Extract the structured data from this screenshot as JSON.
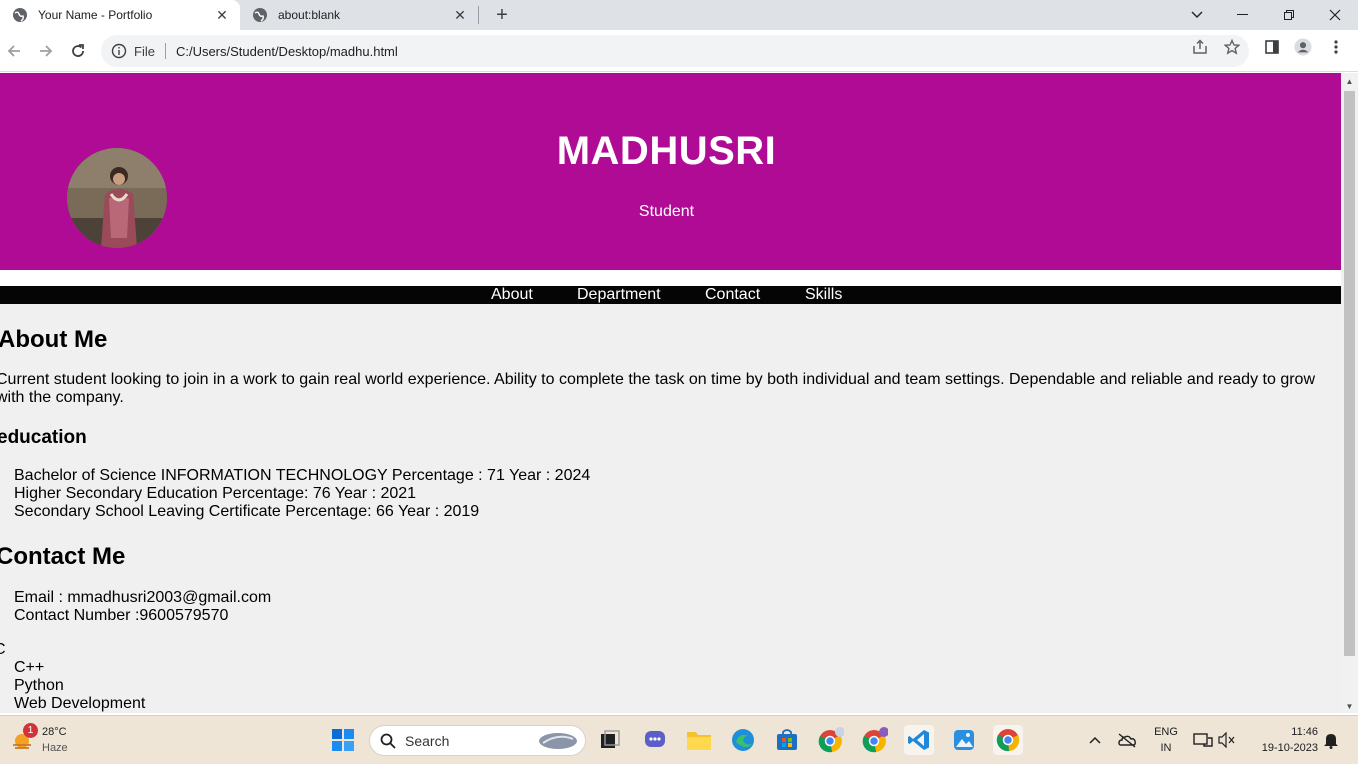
{
  "browser": {
    "tabs": [
      {
        "title": "Your Name - Portfolio",
        "active": true
      },
      {
        "title": "about:blank",
        "active": false
      }
    ],
    "address": {
      "scheme_label": "File",
      "url": "C:/Users/Student/Desktop/madhu.html"
    }
  },
  "page": {
    "hero": {
      "name": "MADHUSRI",
      "role": "Student"
    },
    "nav": [
      "About",
      "Department",
      "Contact",
      "Skills"
    ],
    "about": {
      "heading": "About Me",
      "text_line1": "Current student looking to join in a work to gain real world experience. Ability to complete the task on time by both individual and team settings. Dependable and reliable and ready to grow",
      "text_line2": "with the company."
    },
    "education": {
      "heading": "education",
      "items": [
        "Bachelor of Science INFORMATION TECHNOLOGY Percentage : 71 Year : 2024",
        "Higher Secondary Education Percentage: 76 Year : 2021",
        "Secondary School Leaving Certificate Percentage: 66 Year : 2019"
      ]
    },
    "contact": {
      "heading": "Contact Me",
      "items": [
        "Email : mmadhusri2003@gmail.com",
        "Contact Number :9600579570"
      ]
    },
    "skills": {
      "first": "C",
      "items": [
        "C++",
        "Python",
        "Web Development"
      ]
    }
  },
  "taskbar": {
    "weather": {
      "temp": "28°C",
      "condition": "Haze",
      "badge": "1"
    },
    "search_placeholder": "Search",
    "language": {
      "line1": "ENG",
      "line2": "IN"
    },
    "clock": {
      "time": "11:46",
      "date": "19-10-2023"
    }
  },
  "colors": {
    "hero_bg": "#b00b95",
    "navbar_bg": "#050505",
    "page_bg": "#f0f0f0"
  }
}
